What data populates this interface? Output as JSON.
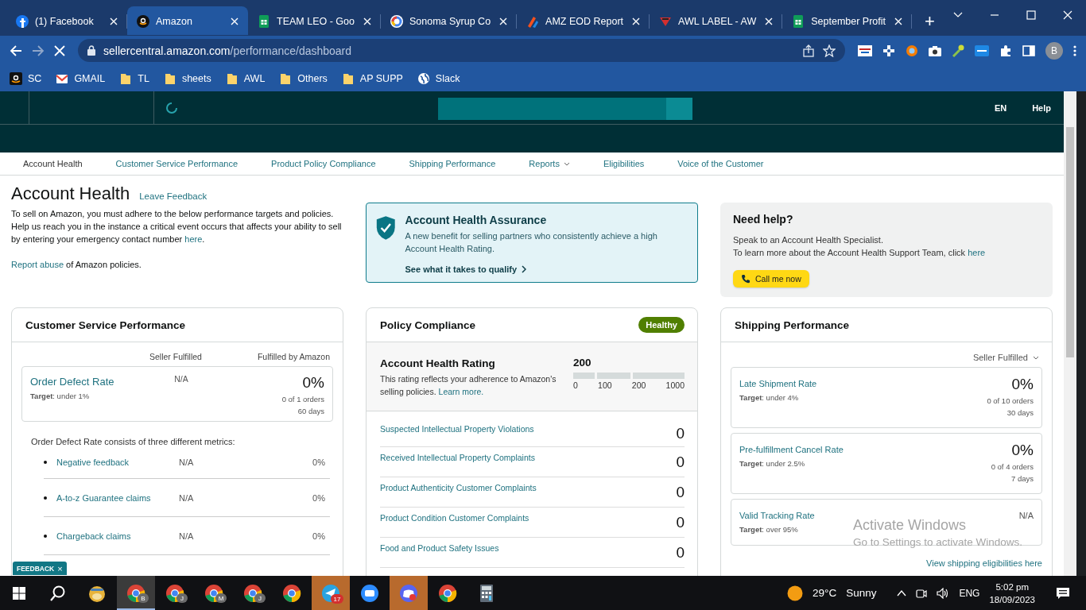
{
  "browser": {
    "tabs": [
      {
        "title": "(1) Facebook",
        "kind": "fb",
        "selected": false
      },
      {
        "title": "Amazon",
        "kind": "amazon",
        "selected": true
      },
      {
        "title": "TEAM LEO - Goo",
        "kind": "sheets",
        "selected": false
      },
      {
        "title": "Sonoma Syrup Co",
        "kind": "google",
        "selected": false
      },
      {
        "title": "AMZ EOD Report",
        "kind": "stripes",
        "selected": false
      },
      {
        "title": "AWL LABEL - AW",
        "kind": "triangle",
        "selected": false
      },
      {
        "title": "September Profit",
        "kind": "sheets",
        "selected": false
      }
    ],
    "new_tab": "+",
    "url_host": "sellercentral.amazon.com",
    "url_path": "/performance/dashboard",
    "profile": "B",
    "bookmarks": [
      {
        "label": "SC",
        "kind": "amazon"
      },
      {
        "label": "GMAIL",
        "kind": "mail"
      },
      {
        "label": "TL",
        "kind": "folder"
      },
      {
        "label": "sheets",
        "kind": "folder"
      },
      {
        "label": "AWL",
        "kind": "folder"
      },
      {
        "label": "Others",
        "kind": "folder"
      },
      {
        "label": "AP SUPP",
        "kind": "folder"
      },
      {
        "label": "Slack",
        "kind": "globe"
      }
    ]
  },
  "header": {
    "language": "EN",
    "help": "Help"
  },
  "nav": [
    {
      "label": "Account Health",
      "kind": "link",
      "selected": true
    },
    {
      "label": "Customer Service Performance",
      "kind": "link",
      "selected": false
    },
    {
      "label": "Product Policy Compliance",
      "kind": "link",
      "selected": false
    },
    {
      "label": "Shipping Performance",
      "kind": "link",
      "selected": false
    },
    {
      "label": "Reports",
      "kind": "dropdown",
      "selected": false
    },
    {
      "label": "Eligibilities",
      "kind": "link",
      "selected": false
    },
    {
      "label": "Voice of the Customer",
      "kind": "link",
      "selected": false
    }
  ],
  "page": {
    "title": "Account Health",
    "feedback_link": "Leave Feedback",
    "intro": [
      [
        {
          "kind": "text",
          "text": "To sell on Amazon, you must adhere to the below performance targets and policies."
        }
      ],
      [
        {
          "kind": "text",
          "text": "Help us reach you in the instance a critical event occurs that affects your ability to sell by entering your emergency contact number "
        },
        {
          "kind": "link",
          "text": "here"
        },
        {
          "kind": "text",
          "text": "."
        }
      ],
      [
        {
          "kind": "link",
          "text": "Report abuse"
        },
        {
          "kind": "text",
          "text": " of Amazon policies."
        }
      ]
    ]
  },
  "assurance": {
    "title": "Account Health Assurance",
    "text": "A new benefit for selling partners who consistently achieve a high Account Health Rating.",
    "link": "See what it takes to qualify"
  },
  "help": {
    "title": "Need help?",
    "lines": [
      [
        {
          "kind": "text",
          "text": "Speak to an Account Health Specialist."
        }
      ],
      [
        {
          "kind": "text",
          "text": "To learn more about the Account Health Support Team, click "
        },
        {
          "kind": "link",
          "text": "here"
        }
      ]
    ],
    "button": "Call me now"
  },
  "customer_service": {
    "title": "Customer Service Performance",
    "columns": [
      "Seller Fulfilled",
      "Fulfilled by Amazon"
    ],
    "odr": {
      "name": "Order Defect Rate",
      "target": "**Target**: under 1%",
      "seller": "N/A",
      "fba": "0%",
      "orders": "0 of 1 orders",
      "period": "60 days"
    },
    "breakdown_intro": "Order Defect Rate consists of three different metrics:",
    "metrics": [
      {
        "name": "Negative feedback",
        "seller": "N/A",
        "fba": "0%"
      },
      {
        "name": "A-to-z Guarantee claims",
        "seller": "N/A",
        "fba": "0%"
      },
      {
        "name": "Chargeback claims",
        "seller": "N/A",
        "fba": "0%"
      }
    ]
  },
  "policy": {
    "title": "Policy Compliance",
    "status": "Healthy",
    "rating_title": "Account Health Rating",
    "rating_text": [
      {
        "kind": "text",
        "text": "This rating reflects your adherence to Amazon's selling policies. "
      },
      {
        "kind": "link",
        "text": "Learn more."
      }
    ],
    "score": "200",
    "scale": [
      "0",
      "100",
      "200",
      "1000"
    ],
    "rows": [
      {
        "name": "Suspected Intellectual Property Violations",
        "count": "0"
      },
      {
        "name": "Received Intellectual Property Complaints",
        "count": "0"
      },
      {
        "name": "Product Authenticity Customer Complaints",
        "count": "0"
      },
      {
        "name": "Product Condition Customer Complaints",
        "count": "0"
      },
      {
        "name": "Food and Product Safety Issues",
        "count": "0"
      }
    ]
  },
  "shipping": {
    "title": "Shipping Performance",
    "filter": "Seller Fulfilled",
    "metrics": [
      {
        "name": "Late Shipment Rate",
        "target": "**Target**: under 4%",
        "value": "0%",
        "orders": "0 of 10 orders",
        "period": "30 days"
      },
      {
        "name": "Pre-fulfillment Cancel Rate",
        "target": "**Target**: under 2.5%",
        "value": "0%",
        "orders": "0 of 4 orders",
        "period": "7 days"
      },
      {
        "name": "Valid Tracking Rate",
        "target": "**Target**: over 95%",
        "value": "N/A"
      }
    ],
    "link": "View shipping eligibilities here"
  },
  "feedback_tab": {
    "label": "FEEDBACK",
    "close": "×"
  },
  "activation_notice": {
    "title": "Activate Windows",
    "text": "Go to Settings to activate Windows."
  },
  "taskbar": {
    "apps": [
      {
        "kind": "mascot",
        "selected": false,
        "flashing": false
      },
      {
        "kind": "chrome",
        "badge": "B",
        "selected": true,
        "flashing": false
      },
      {
        "kind": "chrome",
        "badge": "J",
        "selected": false,
        "flashing": false
      },
      {
        "kind": "chrome",
        "badge": "M",
        "selected": false,
        "flashing": false
      },
      {
        "kind": "chrome",
        "badge": "J",
        "selected": false,
        "flashing": false
      },
      {
        "kind": "chrome",
        "selected": false,
        "flashing": false
      },
      {
        "kind": "telegram",
        "badge": "17",
        "selected": false,
        "flashing": true
      },
      {
        "kind": "zoom",
        "selected": false,
        "flashing": false
      },
      {
        "kind": "discord",
        "selected": false,
        "flashing": true
      },
      {
        "kind": "chrome",
        "selected": false,
        "flashing": false
      },
      {
        "kind": "calculator",
        "selected": false,
        "flashing": false
      }
    ],
    "temperature": "29°C",
    "weather": "Sunny",
    "language": "ENG",
    "time": "5:02 pm",
    "date": "18/09/2023"
  }
}
